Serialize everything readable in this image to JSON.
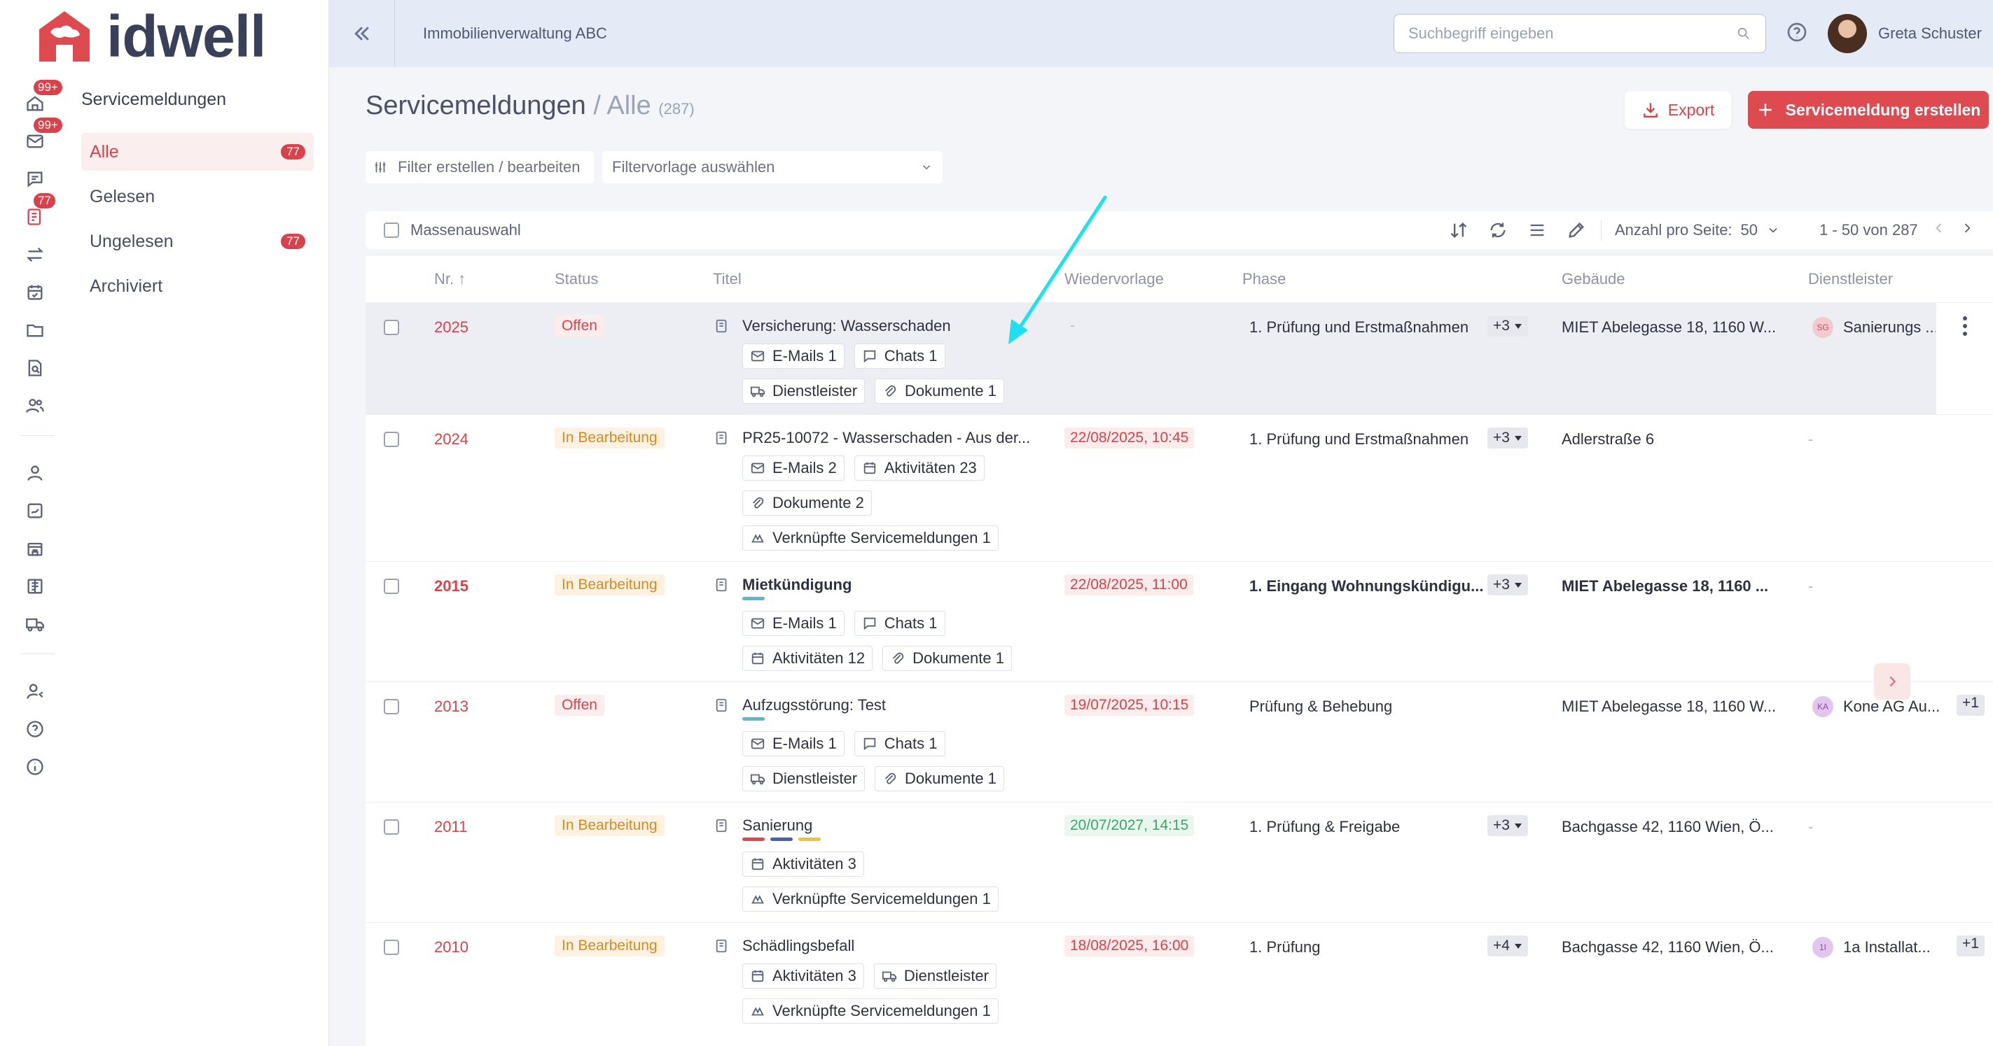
{
  "app": {
    "logo_text": "idwell",
    "company": "Immobilienverwaltung ABC"
  },
  "colors": {
    "accent": "#d9424b",
    "topbar": "#e4ebf7",
    "annotation": "#1fe0f0"
  },
  "rail": [
    {
      "icon": "home-icon",
      "badge": "99+"
    },
    {
      "icon": "mail-icon",
      "badge": "99+"
    },
    {
      "icon": "chat-icon",
      "badge": ""
    },
    {
      "icon": "service-ticket-icon",
      "badge": "77"
    },
    {
      "icon": "transfer-icon",
      "badge": ""
    },
    {
      "icon": "calendar-icon",
      "badge": ""
    },
    {
      "icon": "folder-icon",
      "badge": ""
    },
    {
      "icon": "document-search-icon",
      "badge": ""
    },
    {
      "icon": "users-icon",
      "badge": ""
    },
    {
      "icon": "person-icon",
      "badge": ""
    },
    {
      "icon": "contract-icon",
      "badge": ""
    },
    {
      "icon": "building-icon",
      "badge": ""
    },
    {
      "icon": "ledger-icon",
      "badge": ""
    },
    {
      "icon": "truck-icon",
      "badge": ""
    },
    {
      "icon": "user-settings-icon",
      "badge": ""
    },
    {
      "icon": "help-icon",
      "badge": ""
    },
    {
      "icon": "info-icon",
      "badge": ""
    }
  ],
  "subnav": {
    "title": "Servicemeldungen",
    "items": [
      {
        "label": "Alle",
        "count": "77"
      },
      {
        "label": "Gelesen",
        "count": ""
      },
      {
        "label": "Ungelesen",
        "count": "77"
      },
      {
        "label": "Archiviert",
        "count": ""
      }
    ]
  },
  "topbar": {
    "search_placeholder": "Suchbegriff eingeben",
    "user_name": "Greta Schuster"
  },
  "page": {
    "title": "Servicemeldungen",
    "separator": "/",
    "subtitle": "Alle",
    "total": "(287)",
    "export_label": "Export",
    "create_label": "Servicemeldung erstellen",
    "filter_label": "Filter erstellen / bearbeiten",
    "filter_template_label": "Filtervorlage auswählen"
  },
  "toolbar": {
    "mass_select_label": "Massenauswahl",
    "per_page_label": "Anzahl pro Seite:",
    "per_page_value": "50",
    "range": "1 - 50 von 287"
  },
  "table": {
    "headers": {
      "nr": "Nr.",
      "status": "Status",
      "titel": "Titel",
      "wiedervorlage": "Wiedervorlage",
      "phase": "Phase",
      "gebaeude": "Gebäude",
      "dienstleister": "Dienstleister"
    },
    "rows": [
      {
        "nr": "2025",
        "status": "Offen",
        "title": "Versicherung: Wasserschaden",
        "chips": [
          "E-Mails 1",
          "Chats 1",
          "Dienstleister",
          "Dokumente 1"
        ],
        "wiedervorlage": "-",
        "phase": "1. Prüfung und Erstmaßnahmen",
        "phase_more": "+3",
        "gebaeude": "MIET Abelegasse 18, 1160 W...",
        "dl_initials": "SG",
        "dienstleister": "Sanierungs ...",
        "dl_more": ""
      },
      {
        "nr": "2024",
        "status": "In Bearbeitung",
        "title": "PR25-10072 - Wasserschaden - Aus der...",
        "chips": [
          "E-Mails 2",
          "Aktivitäten 23",
          "Dokumente 2",
          "Verknüpfte Servicemeldungen 1"
        ],
        "wiedervorlage": "22/08/2025, 10:45",
        "phase": "1. Prüfung und Erstmaßnahmen",
        "phase_more": "+3",
        "gebaeude": "Adlerstraße 6",
        "dl_initials": "",
        "dienstleister": "-",
        "dl_more": ""
      },
      {
        "nr": "2015",
        "status": "In Bearbeitung",
        "title": "Mietkündigung",
        "chips": [
          "E-Mails 1",
          "Chats 1",
          "Aktivitäten 12",
          "Dokumente 1"
        ],
        "wiedervorlage": "22/08/2025, 11:00",
        "phase": "1. Eingang Wohnungskündigu...",
        "phase_more": "+3",
        "gebaeude": "MIET Abelegasse 18, 1160 ...",
        "dl_initials": "",
        "dienstleister": "-",
        "dl_more": ""
      },
      {
        "nr": "2013",
        "status": "Offen",
        "title": "Aufzugsstörung: Test",
        "chips": [
          "E-Mails 1",
          "Chats 1",
          "Dienstleister",
          "Dokumente 1"
        ],
        "wiedervorlage": "19/07/2025, 10:15",
        "phase": "Prüfung & Behebung",
        "phase_more": "",
        "gebaeude": "MIET Abelegasse 18, 1160 W...",
        "dl_initials": "KA",
        "dienstleister": "Kone AG Au...",
        "dl_more": "+1"
      },
      {
        "nr": "2011",
        "status": "In Bearbeitung",
        "title": "Sanierung",
        "chips": [
          "Aktivitäten 3",
          "Verknüpfte Servicemeldungen 1"
        ],
        "wiedervorlage": "20/07/2027, 14:15",
        "phase": "1. Prüfung & Freigabe",
        "phase_more": "+3",
        "gebaeude": "Bachgasse 42, 1160 Wien, Ö...",
        "dl_initials": "",
        "dienstleister": "-",
        "dl_more": ""
      },
      {
        "nr": "2010",
        "status": "In Bearbeitung",
        "title": "Schädlingsbefall",
        "chips": [
          "Aktivitäten 3",
          "Dienstleister",
          "Verknüpfte Servicemeldungen 1"
        ],
        "wiedervorlage": "18/08/2025, 16:00",
        "phase": "1. Prüfung",
        "phase_more": "+4",
        "gebaeude": "Bachgasse 42, 1160 Wien, Ö...",
        "dl_initials": "1I",
        "dienstleister": "1a Installat...",
        "dl_more": "+1"
      }
    ]
  }
}
